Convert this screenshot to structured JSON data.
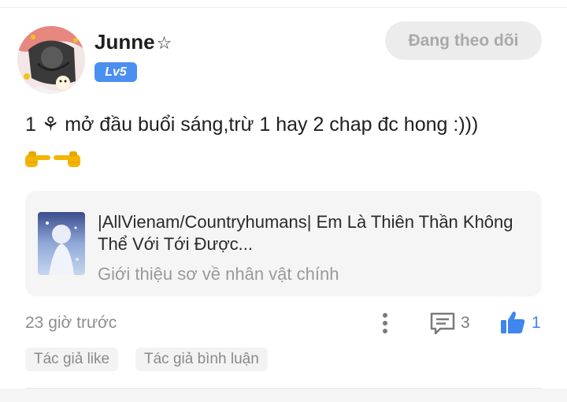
{
  "user": {
    "name": "Junne",
    "name_suffix": "☆",
    "level": "Lv5"
  },
  "follow_button": {
    "label": "Đang theo dõi"
  },
  "post": {
    "text": "1 ⚘ mở đầu buổi sáng,trừ 1 hay 2 chap đc hong :)))",
    "emojis": [
      "backhand-index-pointing-right",
      "backhand-index-pointing-left"
    ]
  },
  "linked_story": {
    "title": "|AllVienam/Countryhumans| Em Là Thiên Thần Không Thể Với Tới Được...",
    "description": "Giới thiệu sơ về nhân vật chính"
  },
  "meta": {
    "time": "23 giờ trước",
    "comment_count": "3",
    "like_count": "1"
  },
  "tags": [
    {
      "label": "Tác giả like"
    },
    {
      "label": "Tác giả bình luận"
    }
  ],
  "colors": {
    "accent": "#4b8ff0",
    "like": "#3f86ee",
    "emoji": "#f5b400"
  },
  "icons": [
    "more-vertical-icon",
    "comment-icon",
    "thumbs-up-icon"
  ]
}
